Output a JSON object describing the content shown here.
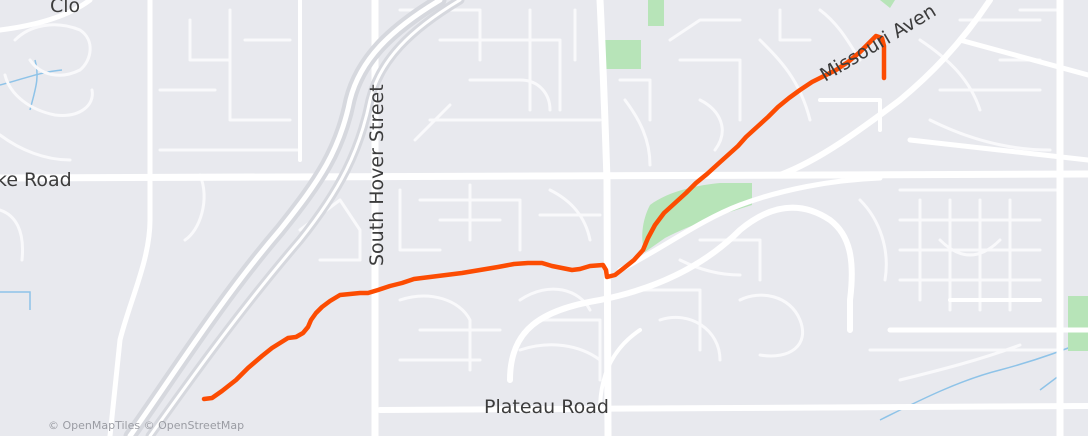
{
  "map": {
    "colors": {
      "background": "#e8e9ee",
      "road": "#ffffff",
      "minor_road": "#f7f7f9",
      "park": "#b7e4b8",
      "water": "#8ec3e8",
      "route": "#fc4c02"
    },
    "labels": {
      "cloud_road": "Clo",
      "lake_road": "ke Road",
      "south_hover": "South Hover Street",
      "missouri_ave": "Missouri Aven",
      "plateau_road": "Plateau Road"
    },
    "attribution": {
      "tiles": "© OpenMapTiles",
      "osm": "© OpenStreetMap"
    }
  }
}
